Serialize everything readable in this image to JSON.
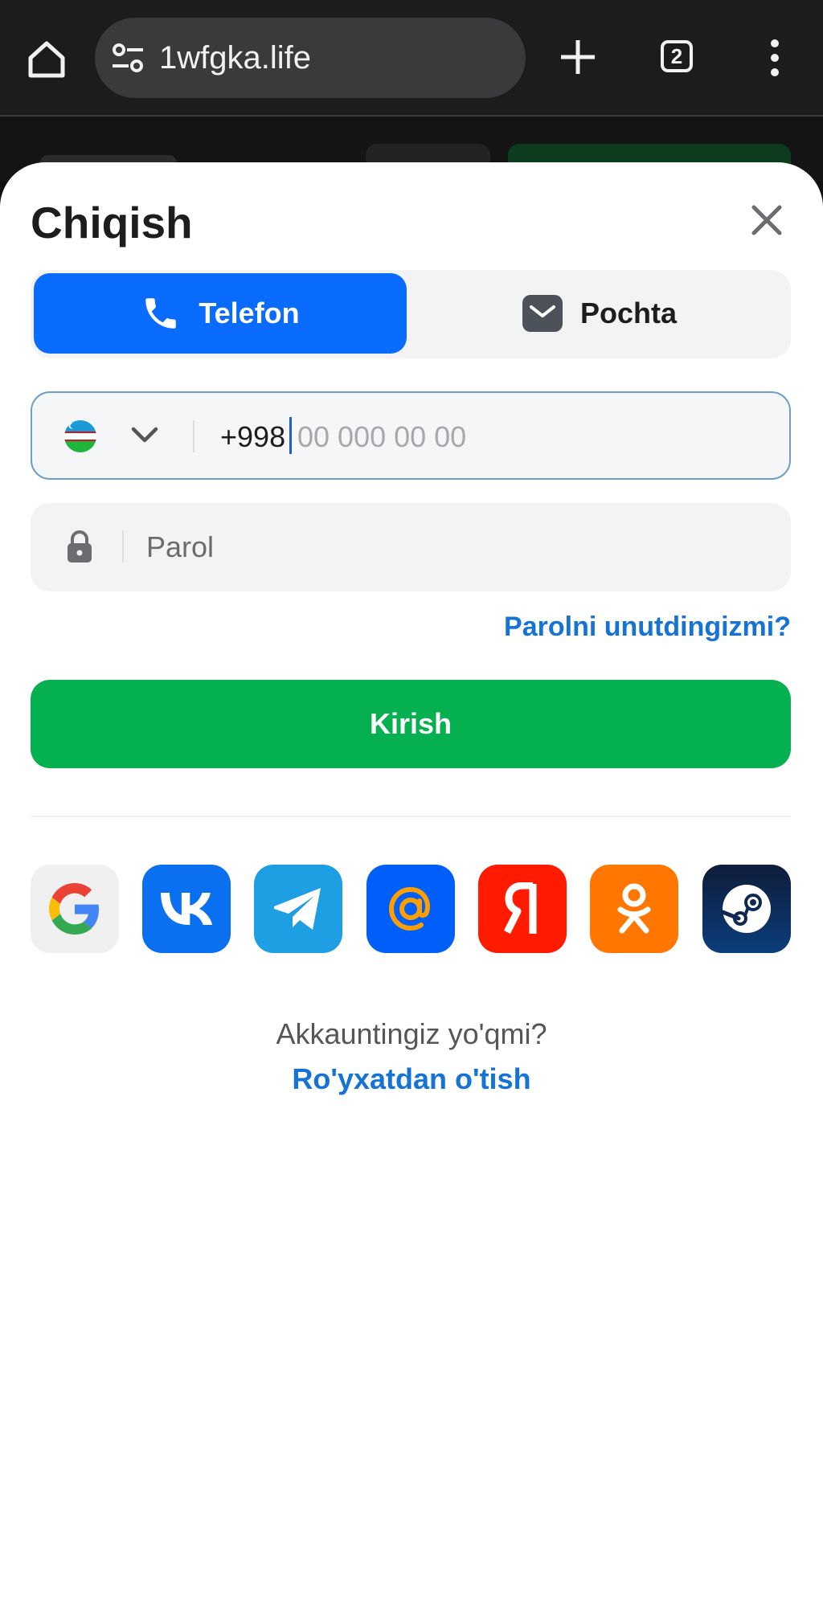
{
  "browser": {
    "url": "1wfgka.life",
    "tab_count": "2",
    "icons": [
      "home-icon",
      "site-settings-icon",
      "new-tab-icon",
      "tab-switcher-icon",
      "menu-icon"
    ]
  },
  "modal": {
    "title": "Chiqish",
    "tabs": [
      {
        "label": "Telefon",
        "icon": "phone-icon",
        "active": true
      },
      {
        "label": "Pochta",
        "icon": "mail-icon",
        "active": false
      }
    ],
    "phone": {
      "country_flag": "uzbekistan-flag-icon",
      "prefix": "+998",
      "placeholder": "00 000 00 00"
    },
    "password": {
      "placeholder": "Parol"
    },
    "forgot_label": "Parolni unutdingizmi?",
    "submit_label": "Kirish",
    "social_logins": [
      "google-icon",
      "vk-icon",
      "telegram-icon",
      "mail-ru-icon",
      "yandex-icon",
      "odnoklassniki-icon",
      "steam-icon"
    ],
    "no_account_text": "Akkauntingiz yo'qmi?",
    "register_label": "Ro'yxatdan o'tish"
  },
  "colors": {
    "primary_blue": "#0a6bff",
    "submit_green": "#04b04f",
    "link_blue": "#1673d6"
  }
}
